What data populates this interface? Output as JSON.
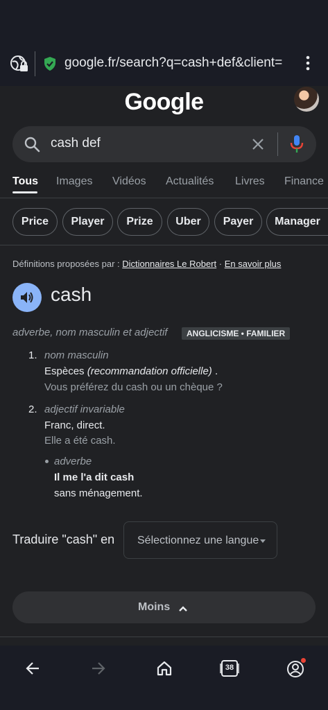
{
  "browser": {
    "url": "google.fr/search?q=cash+def&client="
  },
  "header": {
    "logo_text": "Google"
  },
  "search": {
    "query": "cash def"
  },
  "tabs": [
    {
      "label": "Tous"
    },
    {
      "label": "Images"
    },
    {
      "label": "Vidéos"
    },
    {
      "label": "Actualités"
    },
    {
      "label": "Livres"
    },
    {
      "label": "Finance"
    }
  ],
  "chips": [
    {
      "label": "Price"
    },
    {
      "label": "Player"
    },
    {
      "label": "Prize"
    },
    {
      "label": "Uber"
    },
    {
      "label": "Payer"
    },
    {
      "label": "Manager"
    }
  ],
  "definitions": {
    "source_prefix": "Définitions proposées par :",
    "source_name": "Dictionnaires Le Robert",
    "separator": "·",
    "learn_more": "En savoir plus",
    "word": "cash",
    "grammar": "adverbe, nom masculin et adjectif",
    "tag": "ANGLICISME • FAMILIER",
    "senses": [
      {
        "number": "1.",
        "category": "nom masculin",
        "definition_main": "Espèces",
        "definition_note": "(recommandation officielle)",
        "definition_end": ".",
        "example": "Vous préférez du cash ou un chèque ?"
      },
      {
        "number": "2.",
        "category": "adjectif invariable",
        "definition": "Franc, direct.",
        "example": "Elle a été cash.",
        "sub": {
          "category": "adverbe",
          "phrase": "Il me l'a dit cash",
          "definition": "sans ménagement."
        }
      }
    ]
  },
  "translate": {
    "label": "Traduire \"cash\" en",
    "select_placeholder": "Sélectionnez une langue"
  },
  "less_button": {
    "label": "Moins"
  },
  "bottom_nav": {
    "tab_count": "38"
  },
  "colors": {
    "accent_blue": "#8ab4f8",
    "mic_blue": "#4285f4",
    "mic_red": "#ea4335",
    "secure_green": "#34a853"
  }
}
